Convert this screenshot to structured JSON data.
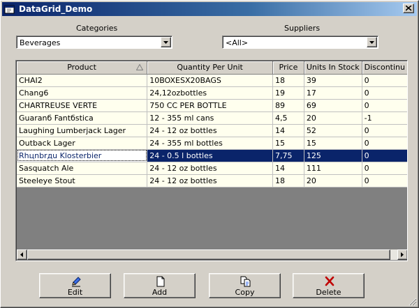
{
  "window": {
    "title": "DataGrid_Demo"
  },
  "filters": {
    "categories_label": "Categories",
    "categories_value": "Beverages",
    "suppliers_label": "Suppliers",
    "suppliers_value": "<All>"
  },
  "grid": {
    "columns": [
      "Product",
      "Quantity Per Unit",
      "Price",
      "Units In Stock",
      "Discontinu"
    ],
    "rows": [
      [
        "CHAI2",
        "10BOXESX20BAGS",
        "18",
        "39",
        "0"
      ],
      [
        "Chang6",
        "24,12ozbottles",
        "19",
        "17",
        "0"
      ],
      [
        "CHARTREUSE VERTE",
        "750 CC PER BOTTLE",
        "89",
        "69",
        "0"
      ],
      [
        "Guaranб Fantбstica",
        "12 - 355 ml cans",
        "4,5",
        "20",
        "-1"
      ],
      [
        "Laughing Lumberjack Lager",
        "24 - 12 oz bottles",
        "14",
        "52",
        "0"
      ],
      [
        "Outback Lager",
        "24 - 355 ml bottles",
        "15",
        "15",
        "0"
      ],
      [
        "Rhцnbrдu Klosterbier",
        "24 - 0.5 l bottles",
        "7,75",
        "125",
        "0"
      ],
      [
        "Sasquatch Ale",
        "24 - 12 oz bottles",
        "14",
        "111",
        "0"
      ],
      [
        "Steeleye Stout",
        "24 - 12 oz bottles",
        "18",
        "20",
        "0"
      ]
    ],
    "selected_row": 6
  },
  "buttons": {
    "edit": "Edit",
    "add": "Add",
    "copy": "Copy",
    "delete": "Delete"
  },
  "icons": {
    "edit": "pencil-icon",
    "add": "new-document-icon",
    "copy": "copy-documents-icon",
    "delete": "red-x-icon"
  },
  "colors": {
    "title_start": "#0a246a",
    "title_end": "#a6caf0",
    "selection": "#0a246a",
    "row_bg": "#ffffee",
    "delete_icon": "#c00000"
  }
}
